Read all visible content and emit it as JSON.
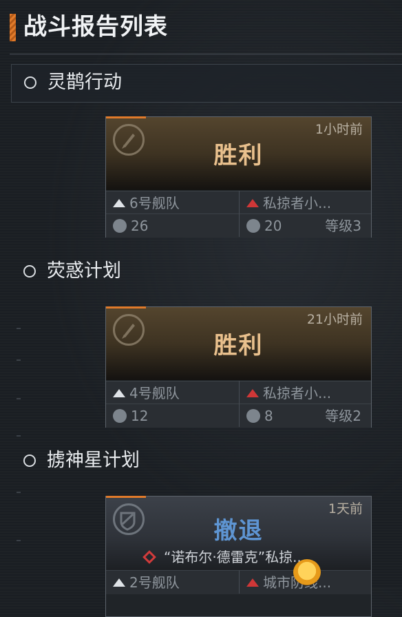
{
  "header": {
    "title": "战斗报告列表"
  },
  "sections": [
    {
      "name": "灵鹊行动",
      "card": {
        "time": "1小时前",
        "result": "胜利",
        "ally_fleet": "6号舰队",
        "enemy": "私掠者小...",
        "ally_count": "26",
        "enemy_count": "20",
        "level": "等级3"
      }
    },
    {
      "name": "荧惑计划",
      "card": {
        "time": "21小时前",
        "result": "胜利",
        "ally_fleet": "4号舰队",
        "enemy": "私掠者小...",
        "ally_count": "12",
        "enemy_count": "8",
        "level": "等级2"
      }
    },
    {
      "name": "掳神星计划",
      "card": {
        "time": "1天前",
        "result": "撤退",
        "subtitle": "“诺布尔·德雷克”私掠...",
        "ally_fleet": "2号舰队",
        "enemy": "城市防线..."
      }
    }
  ],
  "colors": {
    "accent_orange": "#e07a2a",
    "victory_text": "#e9c08d",
    "retreat_text": "#5e95d3",
    "enemy_red": "#d03737"
  },
  "icons": {
    "emblem_victory": "rocket-emblem-icon",
    "emblem_retreat": "shield-emblem-icon",
    "ally": "chevron-up-icon",
    "enemy": "red-chevron-icon",
    "count": "fleet-count-icon"
  }
}
